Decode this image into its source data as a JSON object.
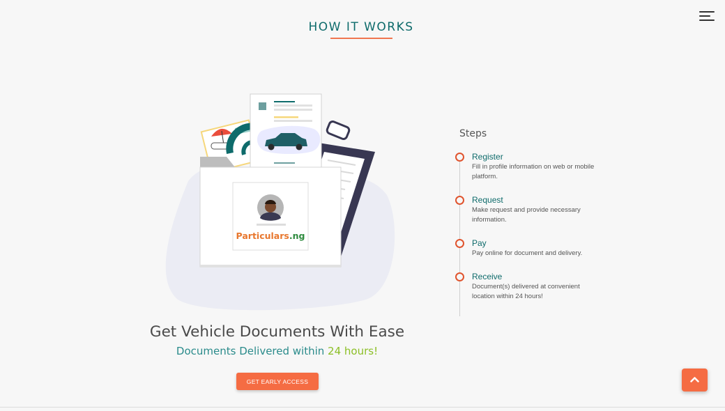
{
  "header": {
    "title": "HOW IT WORKS",
    "menu_icon": "hamburger-menu-icon"
  },
  "illustration": {
    "brand_part1": "Particulars",
    "brand_part2": ".ng"
  },
  "hero": {
    "headline": "Get Vehicle Documents With Ease",
    "subline_main": "Documents Delivered within ",
    "subline_highlight": "24 hours!",
    "cta_label": "GET EARLY ACCESS"
  },
  "steps": {
    "heading": "Steps",
    "items": [
      {
        "title": "Register",
        "description": "Fill in profile information on web or mobile platform."
      },
      {
        "title": "Request",
        "description": "Make request and provide necessary information."
      },
      {
        "title": "Pay",
        "description": "Pay online for document and delivery."
      },
      {
        "title": "Receive",
        "description": "Document(s) delivered at convenient location within 24 hours!"
      }
    ]
  },
  "colors": {
    "brand_teal": "#0e6b6b",
    "accent_orange": "#f56c43",
    "highlight_green": "#8cbf26"
  }
}
